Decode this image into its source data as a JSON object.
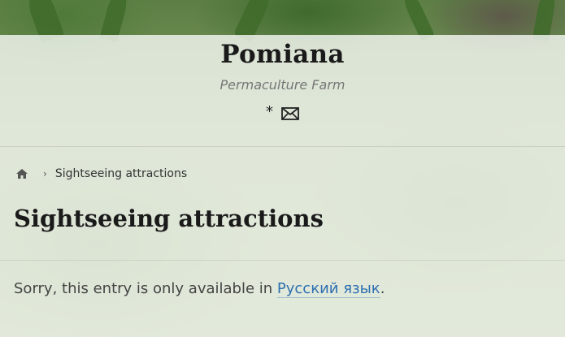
{
  "site": {
    "title": "Pomiana",
    "tagline": "Permaculture Farm",
    "icons": [
      "star-icon",
      "mail-icon"
    ]
  },
  "breadcrumb": {
    "home_icon": "home-icon",
    "separator": "›",
    "current": "Sightseeing attractions"
  },
  "page": {
    "title": "Sightseeing attractions",
    "notice_prefix": "Sorry, this entry is only available in ",
    "language_link": "Русский язык",
    "notice_suffix": "."
  },
  "colors": {
    "link": "#2e6fb0",
    "text": "#444444",
    "title": "#1a1a1a"
  }
}
